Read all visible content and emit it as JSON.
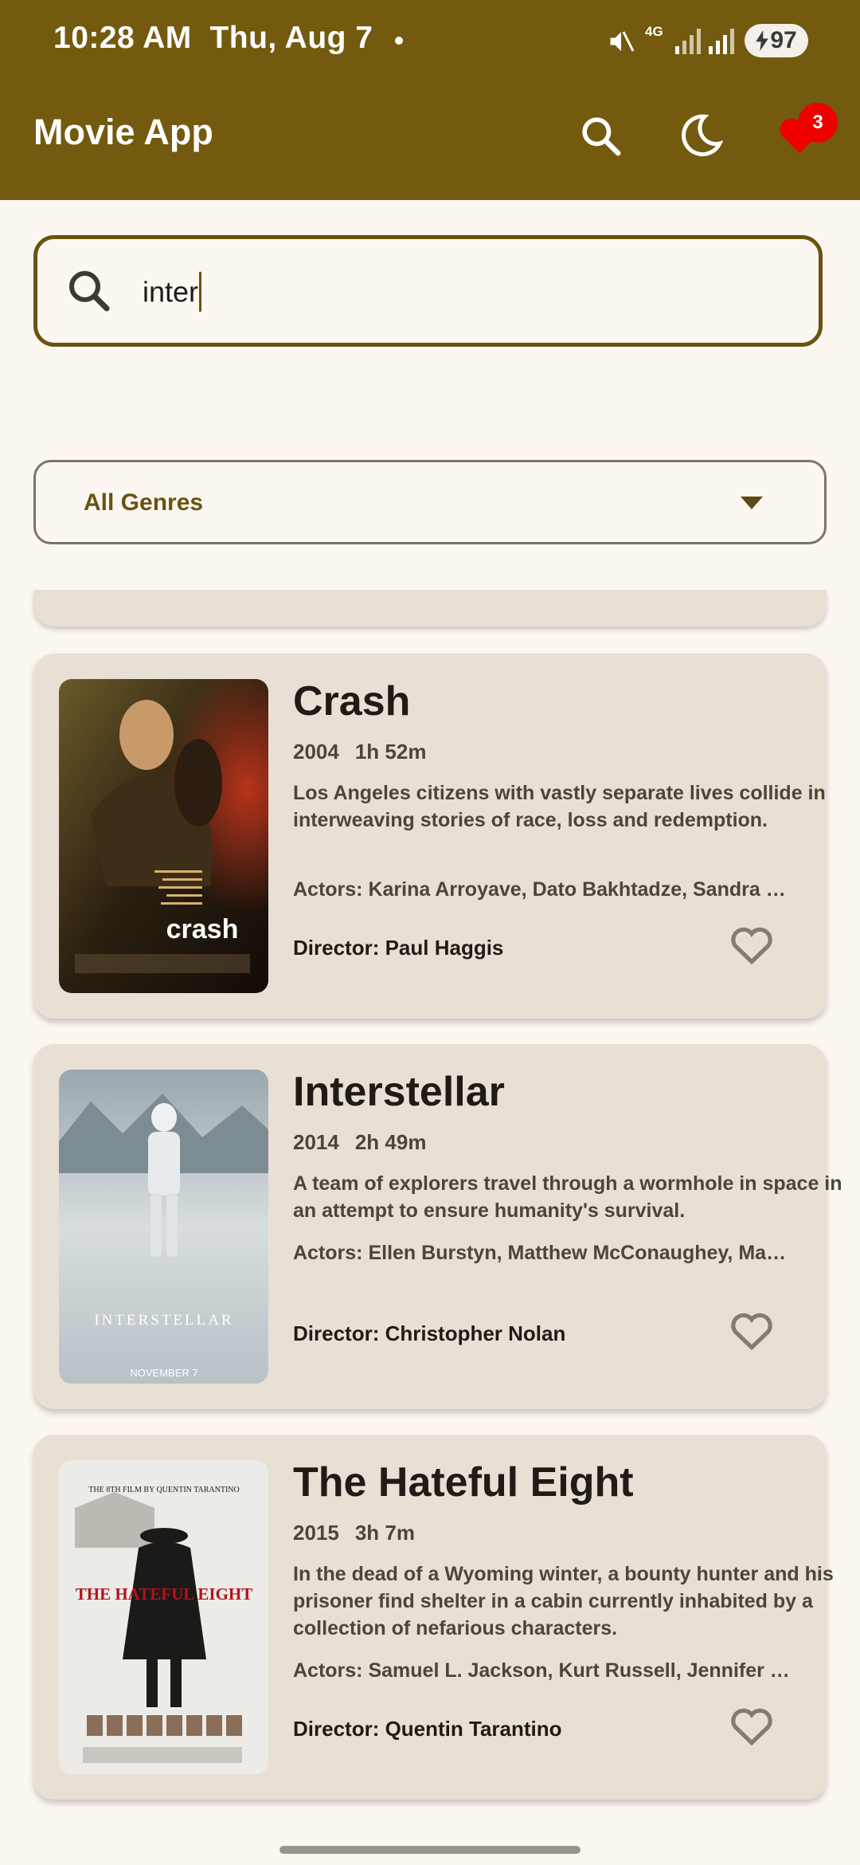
{
  "status_bar": {
    "time": "10:28 AM",
    "date": "Thu, Aug 7",
    "network": "4G",
    "battery": "97"
  },
  "app_bar": {
    "title": "Movie App",
    "favorites_count": "3"
  },
  "search": {
    "value": "inter"
  },
  "genre_filter": {
    "selected": "All Genres"
  },
  "movies": [
    {
      "title": "Crash",
      "year": "2004",
      "duration": "1h 52m",
      "description": "Los Angeles citizens with vastly separate lives collide in interweaving stories of race, loss and redemption.",
      "actors": "Actors: Karina Arroyave, Dato Bakhtadze, Sandra Bullock",
      "director": "Director: Paul Haggis",
      "poster_text": "crash"
    },
    {
      "title": "Interstellar",
      "year": "2014",
      "duration": "2h 49m",
      "description": "A team of explorers travel through a wormhole in space in an attempt to ensure humanity's survival.",
      "actors": "Actors: Ellen Burstyn, Matthew McConaughey, Mackenzie Foy",
      "director": "Director: Christopher Nolan",
      "poster_text": "INTERSTELLAR",
      "poster_tagline": "NOVEMBER 7"
    },
    {
      "title": "The Hateful Eight",
      "year": "2015",
      "duration": "3h 7m",
      "description": "In the dead of a Wyoming winter, a bounty hunter and his prisoner find shelter in a cabin currently inhabited by a collection of nefarious characters.",
      "actors": "Actors: Samuel L. Jackson, Kurt Russell, Jennifer Jason Leigh",
      "director": "Director: Quentin Tarantino",
      "poster_text": "THE HATEFUL EIGHT",
      "poster_tagline": "THE 8TH FILM BY QUENTIN TARANTINO"
    }
  ],
  "colors": {
    "primary": "#745a0f",
    "surface": "#fdf7f2",
    "card": "#e9e0d5",
    "badge": "#e00000"
  }
}
